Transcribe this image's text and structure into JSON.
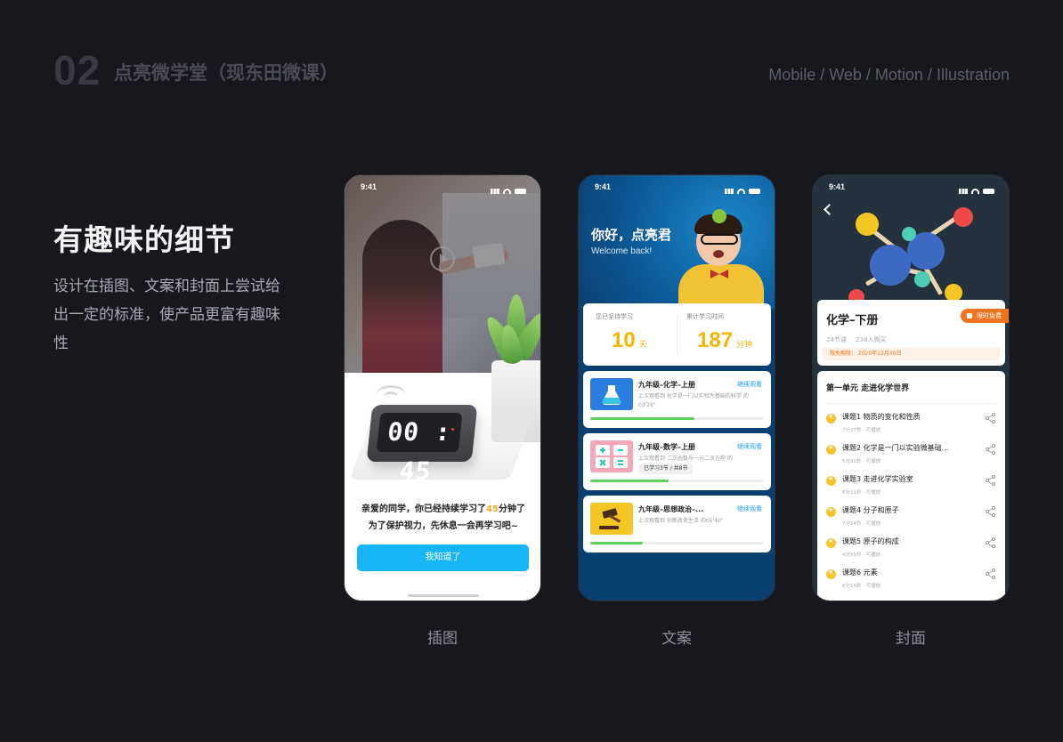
{
  "header": {
    "number": "02",
    "title": "点亮微学堂（现东田微课）",
    "tags": "Mobile / Web / Motion / Illustration"
  },
  "section": {
    "title": "有趣味的细节",
    "description": "设计在插图、文案和封面上尝试给出一定的标准，使产品更富有趣味性"
  },
  "captions": [
    "插图",
    "文案",
    "封面"
  ],
  "phone1": {
    "time": "9:41",
    "clock": "00 : 45",
    "message_pre": "亲爱的同学，你已经持续学习了",
    "message_minutes": "45",
    "message_post": "分钟了",
    "message_line2": "为了保护视力，先休息一会再学习吧~",
    "button": "我知道了"
  },
  "phone2": {
    "time": "9:41",
    "greeting": "你好，点亮君",
    "greeting_en": "Welcome back!",
    "stat1": {
      "label": "您已坚持学习",
      "value": "10",
      "unit": "天"
    },
    "stat2": {
      "label": "累计学习时间",
      "value": "187",
      "unit": "分钟"
    },
    "courses": [
      {
        "title": "九年级–化学–上册",
        "action": "继续观看",
        "sub": "上次观看到 化学是一门以实验为基础的科学 的03'26\"",
        "progress": 0.6,
        "icon_color": "#2a7de1",
        "icon": "flask-icon"
      },
      {
        "title": "九年级–数学–上册",
        "action": "继续观看",
        "sub": "上次观看到 二次函数与一元二次方程 的",
        "tip": "已学习3节 / 共8节",
        "progress": 0.45,
        "icon_color": "#f4a7b9",
        "icon": "math-icon"
      },
      {
        "title": "九年级–思想政治–...",
        "action": "继续观看",
        "sub": "上次观看到 创新改变生活 的05'40\"",
        "progress": 0.3,
        "icon_color": "#f3c623",
        "icon": "gavel-icon"
      }
    ]
  },
  "phone3": {
    "time": "9:41",
    "title": "化学–下册",
    "badge": "限时免费",
    "lessons_count": "24节课",
    "buyers": "238人购买",
    "free_until": "限免期限：  2020年12月30日",
    "unit_title": "第一单元 走进化学世界",
    "lessons": [
      {
        "title": "课题1 物质的变化和性质",
        "meta": "7分27秒 · 可播放"
      },
      {
        "title": "课题2 化学是一门以实验微基础...",
        "meta": "5分30秒 · 可播放"
      },
      {
        "title": "课题3 走进化学实验室",
        "meta": "8分11秒 · 可播放"
      },
      {
        "title": "课题4 分子和原子",
        "meta": "7分14秒 · 可播放"
      },
      {
        "title": "课题5 原子的构成",
        "meta": "4分55秒 · 可播放"
      },
      {
        "title": "课题6 元素",
        "meta": "6分19秒 · 可播放"
      }
    ]
  }
}
